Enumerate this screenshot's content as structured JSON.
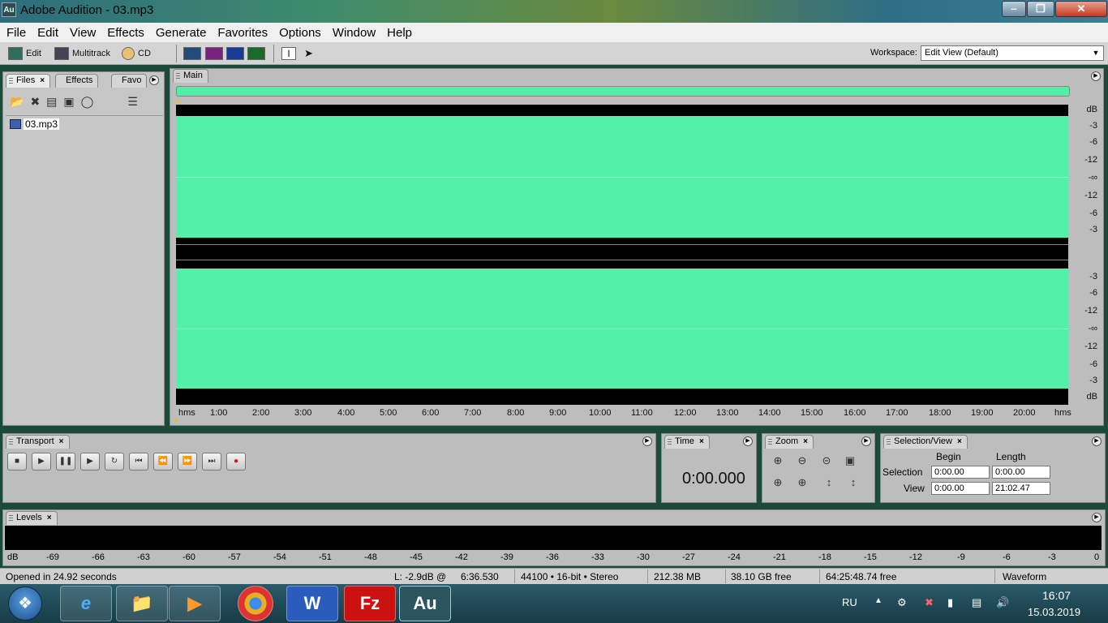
{
  "window": {
    "title": "Adobe Audition - 03.mp3",
    "app_icon": "Au"
  },
  "menu": [
    "File",
    "Edit",
    "View",
    "Effects",
    "Generate",
    "Favorites",
    "Options",
    "Window",
    "Help"
  ],
  "toolbar": {
    "edit_label": "Edit",
    "multitrack_label": "Multitrack",
    "cd_label": "CD",
    "workspace_label": "Workspace:",
    "workspace_value": "Edit View (Default)"
  },
  "files_panel": {
    "tabs": [
      "Files",
      "Effects",
      "Favo"
    ],
    "items": [
      {
        "name": "03.mp3"
      }
    ]
  },
  "main_panel": {
    "tab": "Main",
    "db_labels": [
      "dB",
      "-3",
      "-6",
      "-12",
      "-∞",
      "-12",
      "-6",
      "-3",
      "-3",
      "-6",
      "-12",
      "-∞",
      "-12",
      "-6",
      "-3",
      "dB"
    ],
    "time_ticks": [
      "hms",
      "1:00",
      "2:00",
      "3:00",
      "4:00",
      "5:00",
      "6:00",
      "7:00",
      "8:00",
      "9:00",
      "10:00",
      "11:00",
      "12:00",
      "13:00",
      "14:00",
      "15:00",
      "16:00",
      "17:00",
      "18:00",
      "19:00",
      "20:00",
      "hms"
    ],
    "waveform_color": "#52f0a8"
  },
  "transport": {
    "tab": "Transport"
  },
  "time_panel": {
    "tab": "Time",
    "value": "0:00.000"
  },
  "zoom_panel": {
    "tab": "Zoom"
  },
  "selection_view": {
    "tab": "Selection/View",
    "begin_header": "Begin",
    "length_header": "Length",
    "selection_label": "Selection",
    "view_label": "View",
    "selection_begin": "0:00.00",
    "selection_length": "0:00.00",
    "view_begin": "0:00.00",
    "view_length": "21:02.47"
  },
  "levels": {
    "tab": "Levels",
    "scale": [
      "dB",
      "-69",
      "-66",
      "-63",
      "-60",
      "-57",
      "-54",
      "-51",
      "-48",
      "-45",
      "-42",
      "-39",
      "-36",
      "-33",
      "-30",
      "-27",
      "-24",
      "-21",
      "-18",
      "-15",
      "-12",
      "-9",
      "-6",
      "-3",
      "0"
    ]
  },
  "status": {
    "message": "Opened in 24.92 seconds",
    "level": "L: -2.9dB @",
    "position": "6:36.530",
    "format": "44100 • 16-bit • Stereo",
    "size": "212.38 MB",
    "disk_free": "38.10 GB free",
    "time_free": "64:25:48.74 free",
    "mode": "Waveform"
  },
  "taskbar": {
    "language": "RU",
    "time": "16:07",
    "date": "15.03.2019"
  }
}
